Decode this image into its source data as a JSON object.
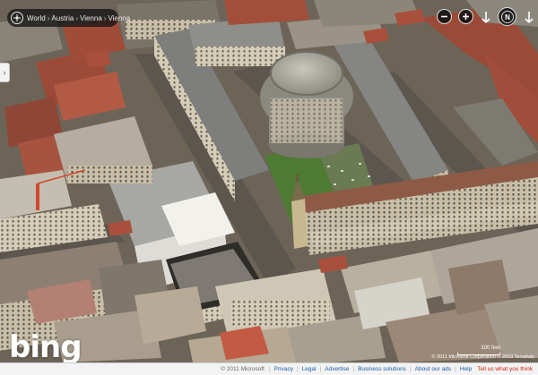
{
  "breadcrumb": {
    "items": [
      "World",
      "Austria",
      "Vienna",
      "Vienna"
    ],
    "separator": "›"
  },
  "map": {
    "view": "bird's eye aerial",
    "colors": {
      "rooftop_red": "#a8503c",
      "rooftop_grey": "#8a8c8c",
      "rotunda": "#b0aea4",
      "park_green": "#4e7a34"
    }
  },
  "controls": {
    "zoom_out_icon": "minus-icon",
    "zoom_in_icon": "plus-icon",
    "rotate_left_icon": "rotate-left-arrow-icon",
    "compass_icon": "compass-icon",
    "compass_label": "N",
    "rotate_right_icon": "rotate-right-arrow-icon"
  },
  "logo": {
    "text": "bing"
  },
  "scale": {
    "label": "100 feet"
  },
  "image_credit": "© 2011 Microsoft Corporation © 2010 Terraitaly",
  "footer": {
    "copyright": "© 2011 Microsoft",
    "links": [
      "Privacy",
      "Legal",
      "Advertise",
      "Business solutions",
      "About our ads",
      "Help"
    ],
    "feedback": "Tell us what you think"
  }
}
